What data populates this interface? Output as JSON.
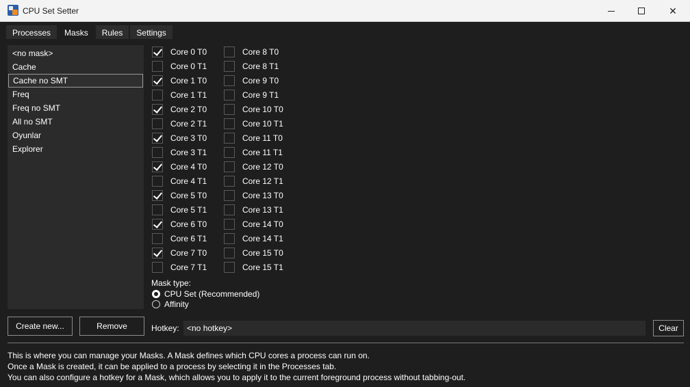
{
  "window": {
    "title": "CPU Set Setter",
    "icon": "app-icon",
    "controls": {
      "minimize": "minimize-icon",
      "maximize": "maximize-icon",
      "close": "close-icon"
    }
  },
  "tabs": [
    {
      "label": "Processes",
      "active": false
    },
    {
      "label": "Masks",
      "active": true
    },
    {
      "label": "Rules",
      "active": false
    },
    {
      "label": "Settings",
      "active": false
    }
  ],
  "masks": {
    "items": [
      "<no mask>",
      "Cache",
      "Cache no SMT",
      "Freq",
      "Freq no SMT",
      "All no SMT",
      "Oyunlar",
      "Explorer"
    ],
    "selected": "Cache no SMT"
  },
  "cores": {
    "column1": [
      {
        "label": "Core 0 T0",
        "checked": true
      },
      {
        "label": "Core 0 T1",
        "checked": false
      },
      {
        "label": "Core 1 T0",
        "checked": true
      },
      {
        "label": "Core 1 T1",
        "checked": false
      },
      {
        "label": "Core 2 T0",
        "checked": true
      },
      {
        "label": "Core 2 T1",
        "checked": false
      },
      {
        "label": "Core 3 T0",
        "checked": true
      },
      {
        "label": "Core 3 T1",
        "checked": false
      },
      {
        "label": "Core 4 T0",
        "checked": true
      },
      {
        "label": "Core 4 T1",
        "checked": false
      },
      {
        "label": "Core 5 T0",
        "checked": true
      },
      {
        "label": "Core 5 T1",
        "checked": false
      },
      {
        "label": "Core 6 T0",
        "checked": true
      },
      {
        "label": "Core 6 T1",
        "checked": false
      },
      {
        "label": "Core 7 T0",
        "checked": true
      },
      {
        "label": "Core 7 T1",
        "checked": false
      }
    ],
    "column2": [
      {
        "label": "Core 8 T0",
        "checked": false
      },
      {
        "label": "Core 8 T1",
        "checked": false
      },
      {
        "label": "Core 9 T0",
        "checked": false
      },
      {
        "label": "Core 9 T1",
        "checked": false
      },
      {
        "label": "Core 10 T0",
        "checked": false
      },
      {
        "label": "Core 10 T1",
        "checked": false
      },
      {
        "label": "Core 11 T0",
        "checked": false
      },
      {
        "label": "Core 11 T1",
        "checked": false
      },
      {
        "label": "Core 12 T0",
        "checked": false
      },
      {
        "label": "Core 12 T1",
        "checked": false
      },
      {
        "label": "Core 13 T0",
        "checked": false
      },
      {
        "label": "Core 13 T1",
        "checked": false
      },
      {
        "label": "Core 14 T0",
        "checked": false
      },
      {
        "label": "Core 14 T1",
        "checked": false
      },
      {
        "label": "Core 15 T0",
        "checked": false
      },
      {
        "label": "Core 15 T1",
        "checked": false
      }
    ]
  },
  "mask_type": {
    "label": "Mask type:",
    "options": [
      {
        "label": "CPU Set (Recommended)",
        "selected": true
      },
      {
        "label": "Affinity",
        "selected": false
      }
    ]
  },
  "buttons": {
    "create_new": "Create new...",
    "remove": "Remove",
    "clear": "Clear"
  },
  "hotkey": {
    "label": "Hotkey:",
    "value": "<no hotkey>"
  },
  "help_lines": [
    "This is where you can manage your Masks. A Mask defines which CPU cores a process can run on.",
    "Once a Mask is created, it can be applied to a process by selecting it in the Processes tab.",
    "You can also configure a hotkey for a Mask, which allows you to apply it to the current foreground process without tabbing-out."
  ],
  "colors": {
    "background": "#1e1e1e",
    "panel": "#2b2b2b",
    "titlebar": "#f3f3f3",
    "text": "#ffffff"
  }
}
